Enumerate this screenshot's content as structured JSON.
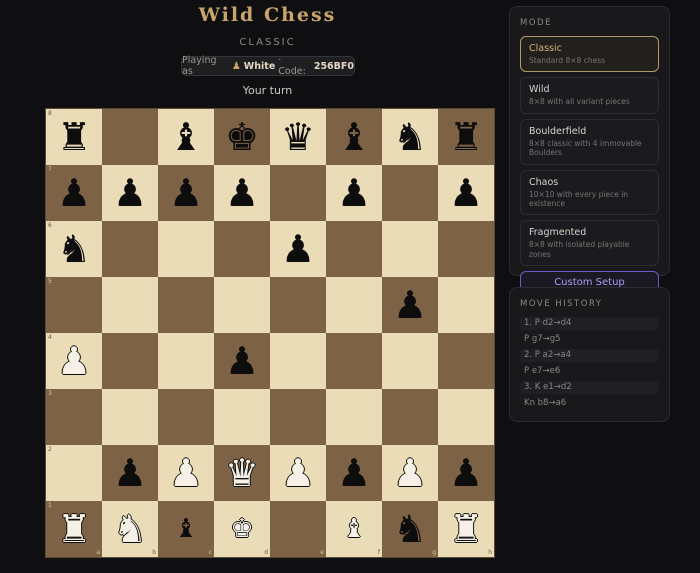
{
  "header": {
    "title": "Wild Chess",
    "subtitle": "CLASSIC",
    "playing_as_label": "Playing as",
    "player_icon": "user-icon",
    "player_color": "White",
    "code_label": "· Code:",
    "game_code": "256BF0",
    "turn_status": "Your turn"
  },
  "colors": {
    "light_square": "#ebdcb8",
    "dark_square": "#7e6245",
    "accent_gold": "#c9a56b",
    "accent_purple": "#6c5bd0"
  },
  "board": {
    "files": [
      "a",
      "b",
      "c",
      "d",
      "e",
      "f",
      "g",
      "h"
    ],
    "ranks": [
      "8",
      "7",
      "6",
      "5",
      "4",
      "3",
      "2",
      "1"
    ],
    "rows": [
      [
        "r",
        "",
        "b",
        "k",
        "q",
        "b",
        "n",
        "r"
      ],
      [
        "p",
        "p",
        "p",
        "p",
        "",
        "p",
        "",
        "p"
      ],
      [
        "n",
        "",
        "",
        "",
        "p",
        "",
        "",
        ""
      ],
      [
        "",
        "",
        "",
        "",
        "",
        "",
        "p",
        ""
      ],
      [
        "P",
        "",
        "",
        "p",
        "",
        "",
        "",
        ""
      ],
      [
        "",
        "",
        "",
        "",
        "",
        "",
        "",
        ""
      ],
      [
        "",
        "p",
        "P",
        "Q",
        "P",
        "p",
        "P",
        "p"
      ],
      [
        "R",
        "N",
        "b",
        "K",
        "",
        "B",
        "n",
        "R"
      ]
    ]
  },
  "mode_panel": {
    "title": "MODE",
    "modes": [
      {
        "name": "Classic",
        "desc": "Standard 8×8 chess",
        "active": true
      },
      {
        "name": "Wild",
        "desc": "8×8 with all variant pieces",
        "active": false
      },
      {
        "name": "Boulderfield",
        "desc": "8×8 classic with 4 immovable Boulders",
        "active": false
      },
      {
        "name": "Chaos",
        "desc": "10×10 with every piece in existence",
        "active": false
      },
      {
        "name": "Fragmented",
        "desc": "8×8 with isolated playable zones",
        "active": false
      }
    ],
    "custom_button": "Custom Setup"
  },
  "history_panel": {
    "title": "MOVE HISTORY",
    "moves": [
      "1. P d2→d4",
      "P g7→g5",
      "2. P a2→a4",
      "P e7→e6",
      "3. K e1→d2",
      "Kn b8→a6"
    ]
  }
}
